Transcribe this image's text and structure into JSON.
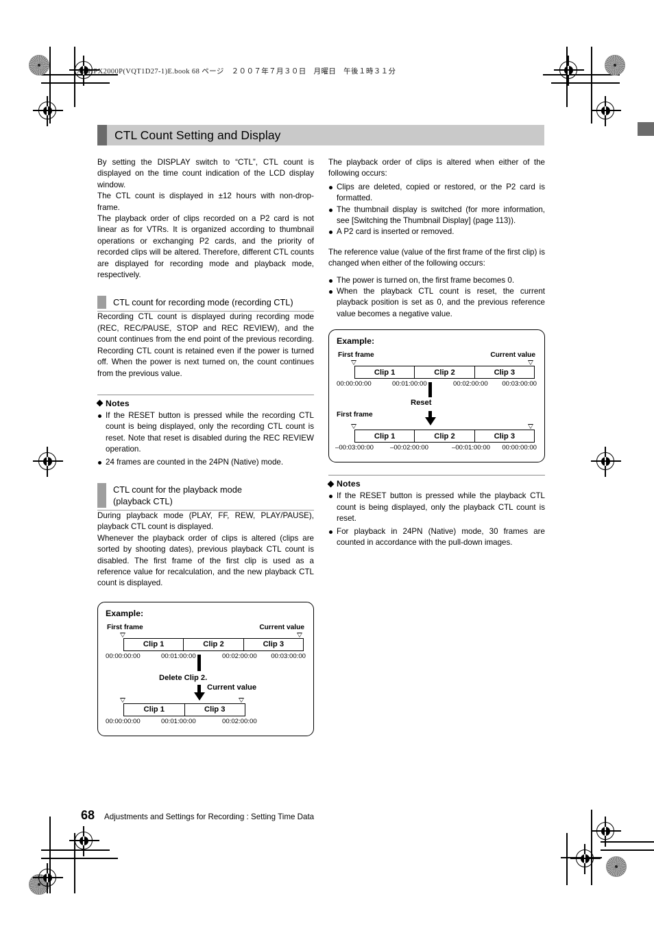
{
  "page_header": "AJ-HPX2000P(VQT1D27-1)E.book  68 ページ　２００７年７月３０日　月曜日　午後１時３１分",
  "title": "CTL Count Setting and Display",
  "left_column": {
    "intro_paragraphs": [
      "By setting the DISPLAY switch to “CTL”, CTL count is displayed on the time count indication of the LCD display window.",
      "The CTL count is displayed in ±12 hours with non-drop-frame.",
      "The playback order of clips recorded on a P2 card is not linear as for VTRs. It is organized according to thumbnail operations or  exchanging  P2 cards, and the priority of recorded clips will be altered. Therefore, different CTL counts are displayed for recording mode and playback mode, respectively."
    ],
    "section_recording": {
      "heading": "CTL count for recording mode (recording CTL)",
      "body": "Recording CTL count is displayed during recording mode (REC, REC/PAUSE, STOP and REC REVIEW), and the count continues from the end point of the previous recording. Recording CTL count is retained even if the power is turned off. When the power is next turned on, the count continues from the previous value."
    },
    "notes": {
      "title": "Notes",
      "items": [
        "If the RESET button is pressed while the recording CTL count is being displayed, only the recording CTL count is reset. Note that reset is disabled during the REC REVIEW operation.",
        "24 frames are counted in the 24PN (Native) mode."
      ]
    },
    "section_playback": {
      "heading_line1": "CTL count for the playback mode",
      "heading_line2": "(playback CTL)",
      "body_paragraphs": [
        "During playback mode (PLAY, FF, REW, PLAY/PAUSE), playback CTL count is displayed.",
        "Whenever the playback order of clips is altered (clips are sorted by shooting dates), previous playback CTL count is disabled. The first frame of the first clip is used as a reference value for recalculation, and the new playback CTL count is displayed."
      ]
    },
    "example": {
      "title": "Example:",
      "label_first_frame": "First frame",
      "label_current_value": "Current value",
      "top_track": {
        "clips": [
          "Clip 1",
          "Clip 2",
          "Clip 3"
        ],
        "timecodes": [
          "00:00:00:00",
          "00:01:00:00",
          "00:02:00:00",
          "00:03:00:00"
        ]
      },
      "mid_caption": "Delete Clip 2.",
      "arrow_label": "Current value",
      "bottom_track": {
        "clips": [
          "Clip 1",
          "Clip 3"
        ],
        "timecodes": [
          "00:00:00:00",
          "00:01:00:00",
          "00:02:00:00"
        ]
      }
    }
  },
  "right_column": {
    "intro": "The playback order of clips is altered when either of the following occurs:",
    "intro_bullets": [
      "Clips are deleted, copied or restored, or the P2 card is formatted.",
      "The thumbnail display is switched (for more information, see [Switching the Thumbnail Display] (page 113)).",
      "A P2 card is inserted or removed."
    ],
    "reference": "The reference value (value of the first frame of the first clip) is changed when either of the following occurs:",
    "reference_bullets": [
      "The power is turned on, the first frame becomes 0.",
      "When the playback CTL count is reset, the current playback position is set as 0, and the previous reference value becomes a negative value."
    ],
    "example": {
      "title": "Example:",
      "label_first_frame": "First frame",
      "label_current_value": "Current value",
      "label_first_frame_2": "First frame",
      "top_track": {
        "clips": [
          "Clip 1",
          "Clip 2",
          "Clip 3"
        ],
        "timecodes": [
          "00:00:00:00",
          "00:01:00:00",
          "00:02:00:00",
          "00:03:00:00"
        ]
      },
      "mid_caption": "Reset",
      "bottom_track": {
        "clips": [
          "Clip 1",
          "Clip 2",
          "Clip 3"
        ],
        "timecodes": [
          "–00:03:00:00",
          "–00:02:00:00",
          "–00:01:00:00",
          "00:00:00:00"
        ]
      }
    },
    "notes": {
      "title": "Notes",
      "items": [
        "If the RESET button is pressed while the playback CTL count is being displayed, only the playback CTL count is reset.",
        "For playback in 24PN (Native) mode, 30 frames are counted in accordance with the pull-down images."
      ]
    }
  },
  "footer": {
    "page_number": "68",
    "text": "Adjustments and Settings for Recording : Setting Time Data"
  }
}
